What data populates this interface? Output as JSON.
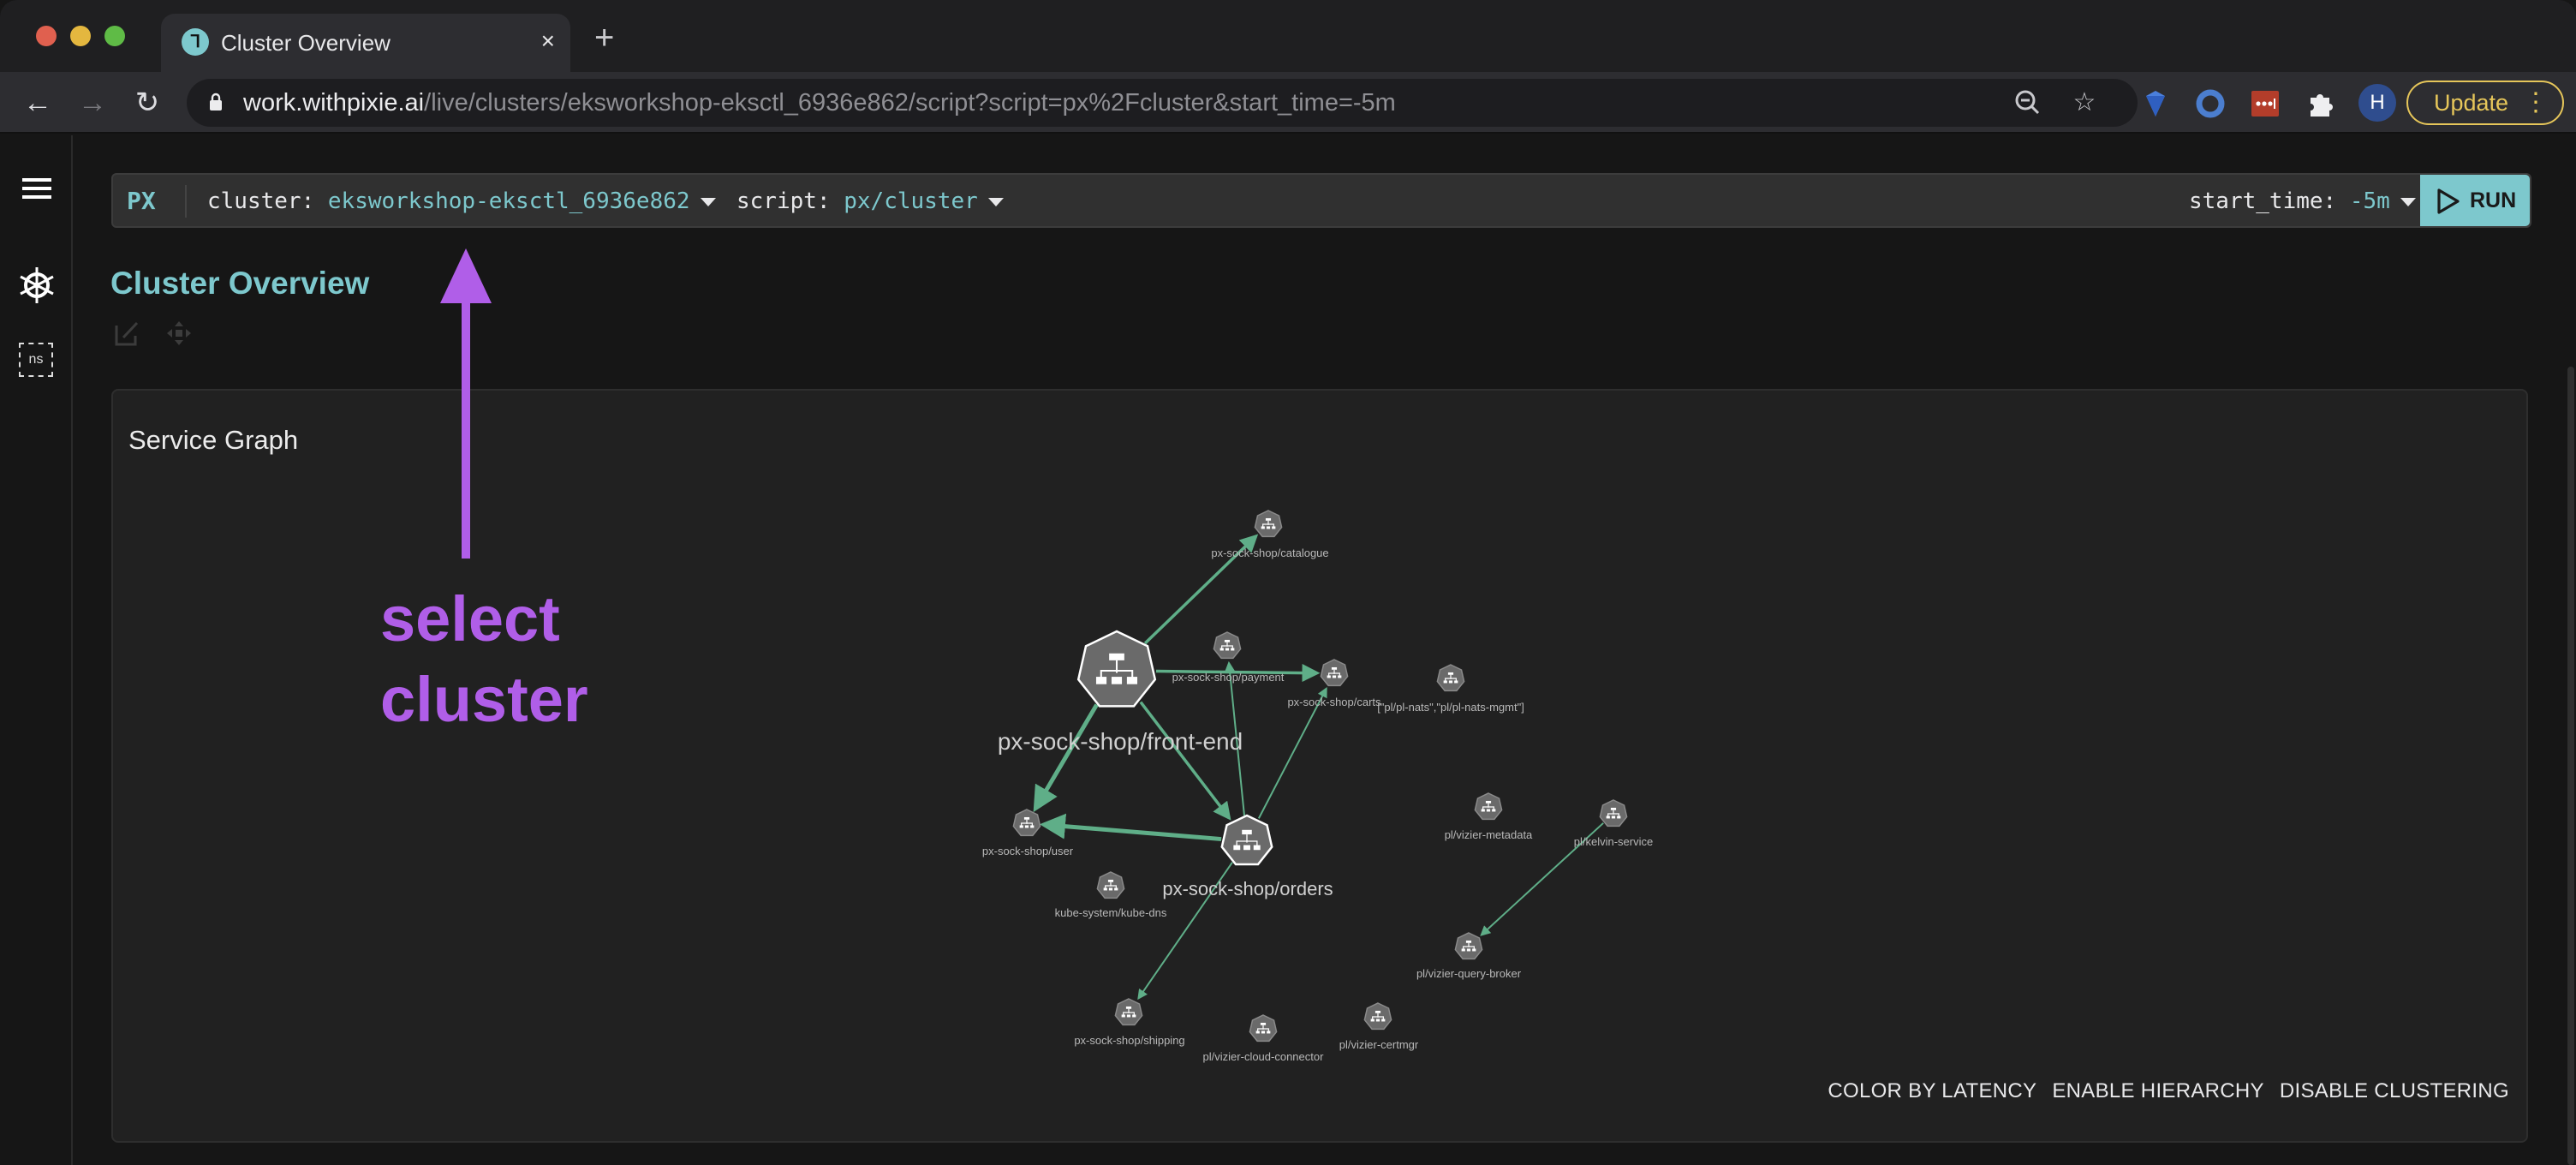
{
  "browser": {
    "tab_title": "Cluster Overview",
    "tab_close_icon": "×",
    "new_tab_icon": "+",
    "url_host": "work.withpixie.ai",
    "url_path": "/live/clusters/eksworkshop-eksctl_6936e862/script?script=px%2Fcluster&start_time=-5m",
    "avatar_initial": "H",
    "update_label": "Update",
    "menu_icon": "⋮",
    "colors": {
      "update": "#e6c65a",
      "avatar": "#2f4d8e"
    }
  },
  "command_bar": {
    "logo": "PX",
    "cluster_key": "cluster:",
    "cluster_value": "eksworkshop-eksctl_6936e862",
    "script_key": "script:",
    "script_value": "px/cluster",
    "start_time_key": "start_time:",
    "start_time_value": "-5m",
    "run_label": "RUN",
    "accent": "#7dc8cd"
  },
  "sidebar": {
    "ns_label": "ns"
  },
  "page": {
    "title": "Cluster Overview"
  },
  "service_graph": {
    "title": "Service Graph",
    "actions": [
      "COLOR BY LATENCY",
      "ENABLE HIERARCHY",
      "DISABLE CLUSTERING"
    ],
    "edge_color": "#5fae88",
    "nodes": [
      {
        "id": "front-end",
        "label": "px-sock-shop/front-end",
        "size": "large"
      },
      {
        "id": "catalogue",
        "label": "px-sock-shop/catalogue",
        "size": "small"
      },
      {
        "id": "payment",
        "label": "px-sock-shop/payment",
        "size": "small"
      },
      {
        "id": "carts",
        "label": "px-sock-shop/carts",
        "size": "small"
      },
      {
        "id": "nats",
        "label": "[\"pl/pl-nats\",\"pl/pl-nats-mgmt\"]",
        "size": "small"
      },
      {
        "id": "user",
        "label": "px-sock-shop/user",
        "size": "small"
      },
      {
        "id": "orders",
        "label": "px-sock-shop/orders",
        "size": "medium"
      },
      {
        "id": "kube-dns",
        "label": "kube-system/kube-dns",
        "size": "small"
      },
      {
        "id": "vizier-metadata",
        "label": "pl/vizier-metadata",
        "size": "small"
      },
      {
        "id": "kelvin",
        "label": "pl/kelvin-service",
        "size": "small"
      },
      {
        "id": "query-broker",
        "label": "pl/vizier-query-broker",
        "size": "small"
      },
      {
        "id": "shipping",
        "label": "px-sock-shop/shipping",
        "size": "small"
      },
      {
        "id": "cloud-connector",
        "label": "pl/vizier-cloud-connector",
        "size": "small"
      },
      {
        "id": "certmgr",
        "label": "pl/vizier-certmgr",
        "size": "small"
      }
    ],
    "edges": [
      {
        "from": "front-end",
        "to": "catalogue",
        "weight": "thick"
      },
      {
        "from": "front-end",
        "to": "carts",
        "weight": "thick"
      },
      {
        "from": "front-end",
        "to": "user",
        "weight": "heavy"
      },
      {
        "from": "front-end",
        "to": "orders",
        "weight": "thick"
      },
      {
        "from": "orders",
        "to": "user",
        "weight": "heavy"
      },
      {
        "from": "orders",
        "to": "payment",
        "weight": "thin"
      },
      {
        "from": "orders",
        "to": "carts",
        "weight": "thin"
      },
      {
        "from": "orders",
        "to": "shipping",
        "weight": "thin"
      },
      {
        "from": "kelvin",
        "to": "query-broker",
        "weight": "thin"
      }
    ]
  },
  "annotation": {
    "line1": "select",
    "line2": "cluster",
    "color": "#b05ee8"
  }
}
